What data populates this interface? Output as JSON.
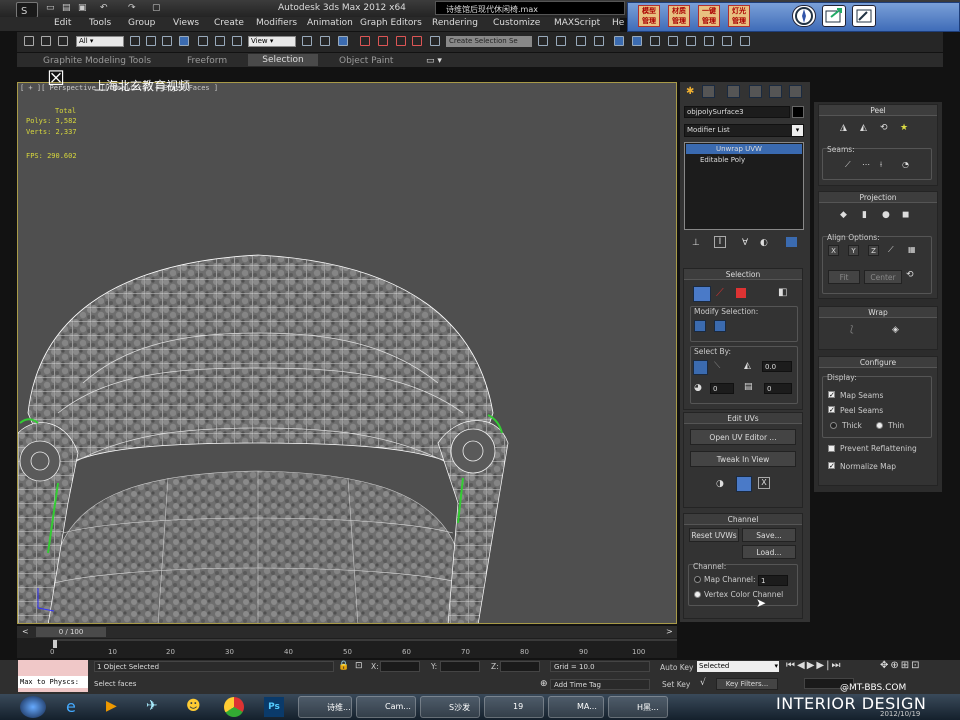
{
  "app": {
    "title": "Autodesk 3ds Max  2012 x64",
    "file": "诗维馆后现代休闲椅.max"
  },
  "menu": [
    "Edit",
    "Tools",
    "Group",
    "Views",
    "Create",
    "Modifiers",
    "Animation",
    "Graph Editors",
    "Rendering",
    "Customize",
    "MAXScript",
    "He"
  ],
  "plugin_toolbar": {
    "buttons": [
      "模型\n管理",
      "材质\n管理",
      "一键\n管理",
      "灯光\n管理"
    ]
  },
  "toolbar": {
    "filter": "All",
    "coord": "View",
    "named_selection": "Create Selection Se"
  },
  "ribbon": {
    "tabs": [
      "Graphite Modeling Tools",
      "Freeform",
      "Selection",
      "Object Paint"
    ],
    "active": "Selection"
  },
  "viewport": {
    "label": "[ + ][ Perspective ][ Realistic + Edged Faces ]",
    "stats": {
      "header": "Total",
      "polys": "Polys: 3,582",
      "verts": "Verts: 2,337",
      "fps": "FPS:  290.602"
    },
    "watermark": "上海北玄教育视频"
  },
  "command_panel": {
    "object_name": "objpolySurface3",
    "modifier_list": "Modifier List",
    "stack": [
      "Unwrap UVW",
      "Editable Poly"
    ],
    "selection": {
      "title": "Selection",
      "modify_selection": "Modify Selection:",
      "select_by": "Select By:",
      "spin1": "0.0",
      "spin2": "0",
      "spin3": "0"
    },
    "edit_uvs": {
      "title": "Edit UVs",
      "open_editor": "Open UV Editor ...",
      "tweak": "Tweak In View"
    },
    "channel": {
      "title": "Channel",
      "reset": "Reset UVWs",
      "save": "Save...",
      "load": "Load...",
      "group": "Channel:",
      "map_channel": "Map Channel:",
      "map_channel_value": "1",
      "vertex_color": "Vertex Color Channel"
    }
  },
  "uv_panel": {
    "peel": {
      "title": "Peel",
      "seams": "Seams:"
    },
    "projection": {
      "title": "Projection",
      "align": "Align Options:",
      "fit": "Fit",
      "center": "Center"
    },
    "wrap": {
      "title": "Wrap"
    },
    "configure": {
      "title": "Configure",
      "display": "Display:",
      "map_seams": "Map Seams",
      "peel_seams": "Peel Seams",
      "thick": "Thick",
      "thin": "Thin",
      "prevent": "Prevent Reflattening",
      "normalize": "Normalize Map"
    }
  },
  "timeline": {
    "frame": "0 / 100",
    "ticks": [
      "0",
      "10",
      "20",
      "30",
      "40",
      "50",
      "60",
      "70",
      "80",
      "90",
      "100"
    ]
  },
  "status": {
    "maxscript": "Max to Physcs:",
    "selected": "1 Object Selected",
    "prompt": "Select faces",
    "x": "X:",
    "y": "Y:",
    "z": "Z:",
    "grid": "Grid = 10.0",
    "add_time_tag": "Add Time Tag",
    "auto_key": "Auto Key",
    "set_key": "Set Key",
    "key_mode": "Selected",
    "key_filters": "Key Filters..."
  },
  "taskbar": {
    "items": [
      "诗维...",
      "Cam...",
      "S沙发",
      "19",
      "MA...",
      "H黑..."
    ]
  },
  "branding": {
    "main": "INTERIOR DESIGN",
    "site": "@MT-BBS.COM",
    "date": "2012/10/19"
  }
}
